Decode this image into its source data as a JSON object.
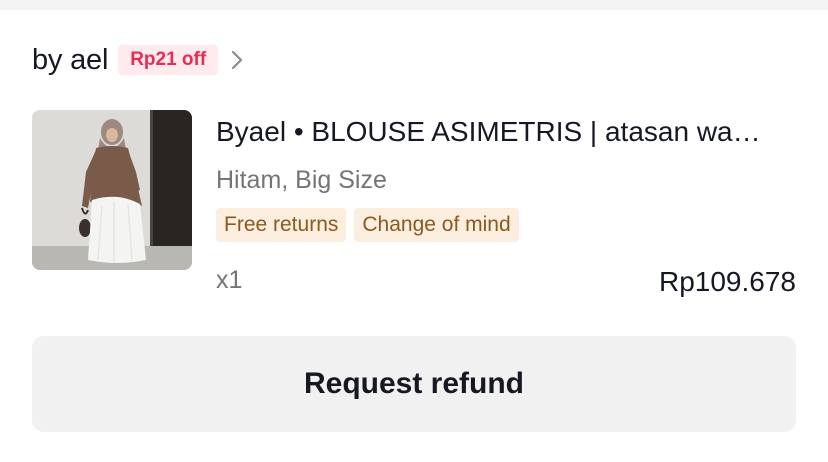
{
  "shop": {
    "name": "by ael",
    "discount_badge": "Rp21 off",
    "chevron_icon": "chevron-right-icon"
  },
  "product": {
    "image_icon": "product-photo",
    "title": "Byael • BLOUSE ASIMETRIS | atasan wa…",
    "variant": "Hitam, Big Size",
    "tags": [
      "Free returns",
      "Change of mind"
    ],
    "quantity": "x1",
    "price": "Rp109.678"
  },
  "actions": {
    "refund_label": "Request refund"
  },
  "colors": {
    "badge_bg": "#fdebee",
    "badge_text": "#ee2a53",
    "tag_bg": "#fbeedf",
    "tag_text": "#8a5a1e",
    "button_bg": "#f1f1f2"
  }
}
